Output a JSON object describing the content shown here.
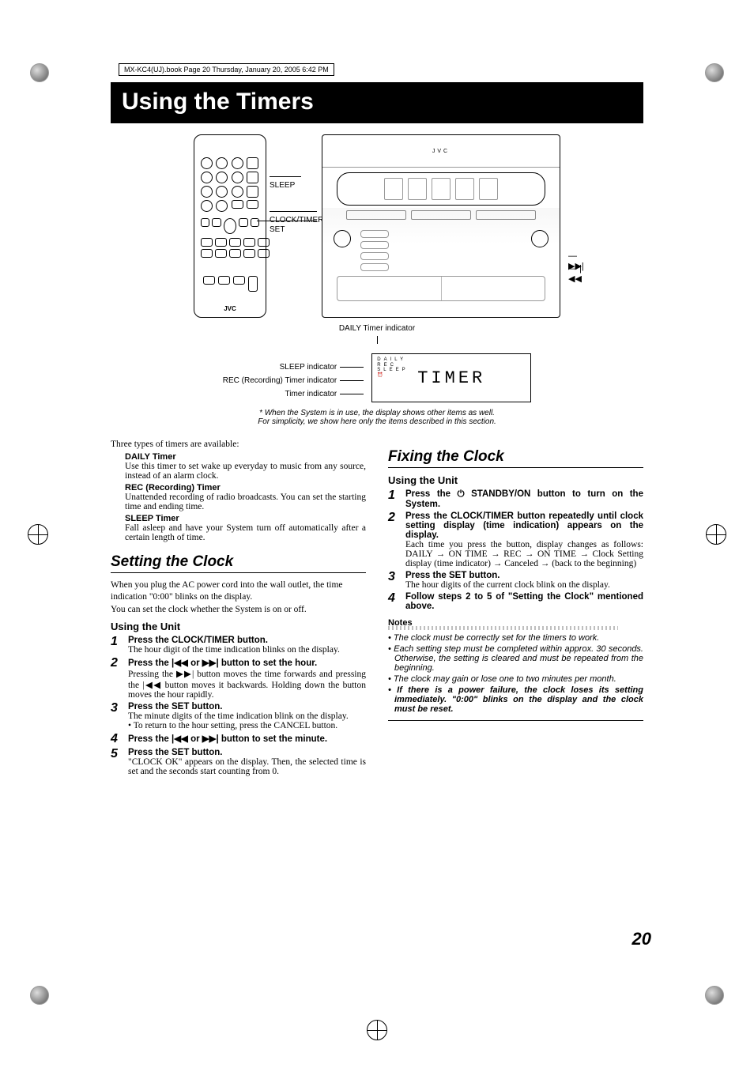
{
  "book_header": "MX-KC4(UJ).book  Page 20  Thursday, January 20, 2005  6:42 PM",
  "title": "Using the Timers",
  "diagram": {
    "remote_labels": {
      "sleep": "SLEEP",
      "clock_timer": "CLOCK/TIMER",
      "set": "SET"
    },
    "remote_brand": "JVC",
    "system_brand": "JVC",
    "track_next": "▶▶|",
    "track_prev": "|◀◀",
    "daily_timer_indicator": "DAILY Timer indicator",
    "sleep_indicator": "SLEEP indicator",
    "rec_indicator": "REC (Recording) Timer indicator",
    "timer_indicator": "Timer indicator",
    "display_text": "TIMER",
    "asterisk_note_1": "*  When the System is in use, the display shows other items as well.",
    "asterisk_note_2": "For simplicity, we show here only the items described in this section."
  },
  "intro": {
    "line": "Three types of timers are available:",
    "daily_term": "DAILY Timer",
    "daily_desc": "Use this timer to set wake up everyday to music from any source, instead of an alarm clock.",
    "rec_term": "REC (Recording) Timer",
    "rec_desc": "Unattended recording of radio broadcasts. You can set the starting time and ending time.",
    "sleep_term": "SLEEP Timer",
    "sleep_desc": "Fall asleep and have your System turn off automatically after a certain length of time."
  },
  "setting": {
    "heading": "Setting the Clock",
    "para1": "When you plug the AC power cord into the wall outlet, the time indication \"0:00\" blinks on the display.",
    "para2": "You can set the clock whether the System is on or off.",
    "subhead": "Using the Unit",
    "s1_t": "Press the CLOCK/TIMER button.",
    "s1_d": "The hour digit of the time indication blinks on the display.",
    "s2_t_a": "Press the ",
    "s2_t_b": " or ",
    "s2_t_c": " button to set the hour.",
    "s2_d": "Pressing the ▶▶| button moves the time forwards and pressing the |◀◀ button moves it backwards. Holding down the button moves the hour rapidly.",
    "s3_t": "Press the SET button.",
    "s3_d": "The minute digits of the time indication blink on the display.",
    "s3_b": "• To return to the hour setting, press the CANCEL button.",
    "s4_t_a": "Press the ",
    "s4_t_b": " or ",
    "s4_t_c": " button to set the minute.",
    "s5_t": "Press the SET button.",
    "s5_d": "\"CLOCK OK\" appears on the display. Then, the selected time is set and the seconds start counting from 0."
  },
  "fixing": {
    "heading": "Fixing the Clock",
    "subhead": "Using the Unit",
    "s1_t_a": "Press the ",
    "s1_t_b": " STANDBY/ON button to turn on the System.",
    "s2_t": "Press the CLOCK/TIMER button repeatedly until clock setting display (time indication) appears on the display.",
    "s2_d": "Each time you press the button, display changes as follows: DAILY → ON TIME → REC → ON TIME → Clock Setting display (time indicator) → Canceled → (back to the beginning)",
    "s3_t": "Press the SET button.",
    "s3_d": "The hour digits of the current clock blink on the display.",
    "s4_t": "Follow steps 2 to 5 of \"Setting the Clock\" mentioned above."
  },
  "notes": {
    "label": "Notes",
    "n1": "• The clock must be correctly set for the timers to work.",
    "n2": "• Each setting step must be completed within approx. 30 seconds. Otherwise, the setting is cleared and must be repeated from the beginning.",
    "n3": "• The clock may gain or lose one to two minutes per month.",
    "n4": "• If there is a power failure, the clock loses its setting immediately. \"0:00\" blinks on the display and the clock must be reset."
  },
  "symbols": {
    "prev": "|◀◀",
    "next": "▶▶|",
    "power": "⏻"
  },
  "page_number": "20"
}
